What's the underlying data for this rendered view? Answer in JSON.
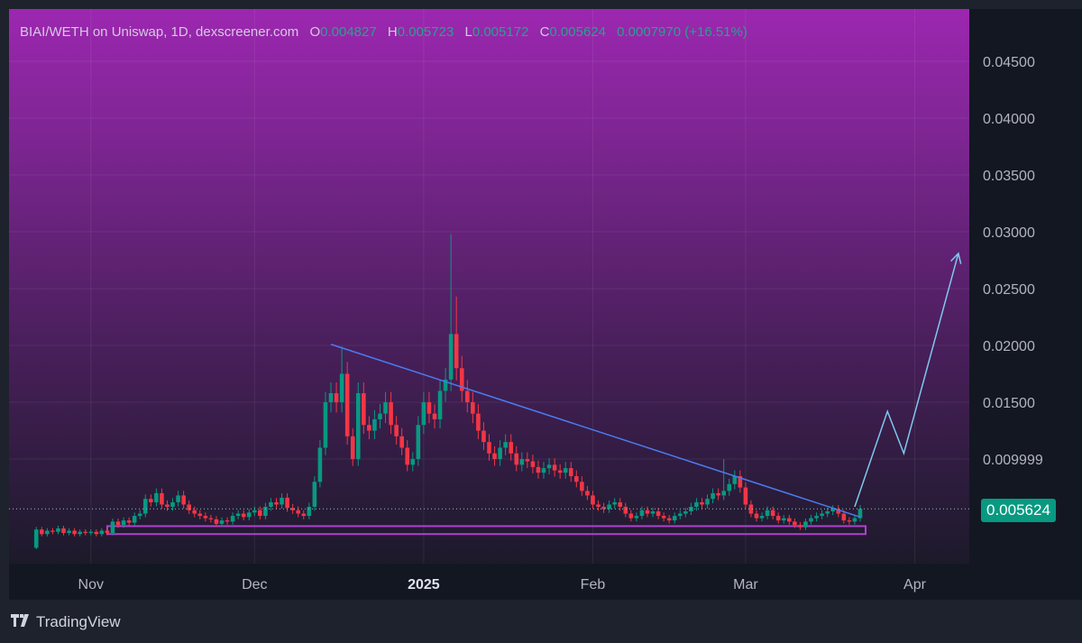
{
  "header": {
    "title": "BIAI/WETH on Uniswap, 1D, dexscreener.com",
    "o_label": "O",
    "open": "0.004827",
    "h_label": "H",
    "high": "0.005723",
    "l_label": "L",
    "low": "0.005172",
    "c_label": "C",
    "close": "0.005624",
    "change": "0.0007970 (+16.51%)"
  },
  "last_price_label": "0.005624",
  "footer": {
    "brand": "TradingView",
    "logo": "TV"
  },
  "colors": {
    "up": "#089981",
    "down": "#f23645",
    "trendline": "#4a7cf0",
    "support": "#b040d0",
    "arrow": "#7ec8f0"
  },
  "chart_data": {
    "type": "candlestick",
    "title": "BIAI/WETH on Uniswap, 1D",
    "start_date": "2024-10-22",
    "y_ticks": [
      "0.04500",
      "0.04000",
      "0.03500",
      "0.03000",
      "0.02500",
      "0.02000",
      "0.01500",
      "0.009999"
    ],
    "y_tick_values": [
      0.045,
      0.04,
      0.035,
      0.03,
      0.025,
      0.02,
      0.015,
      0.01
    ],
    "ylim": [
      0.0008,
      0.0496
    ],
    "x_ticks": [
      {
        "label": "Nov",
        "index": 10,
        "bold": false
      },
      {
        "label": "Dec",
        "index": 40,
        "bold": false
      },
      {
        "label": "2025",
        "index": 71,
        "bold": true
      },
      {
        "label": "Feb",
        "index": 102,
        "bold": false
      },
      {
        "label": "Mar",
        "index": 130,
        "bold": false
      },
      {
        "label": "Apr",
        "index": 161,
        "bold": false
      }
    ],
    "xlim": [
      -5,
      171
    ],
    "first_open": 0.0022,
    "closes": [
      0.0038,
      0.0034,
      0.0037,
      0.0036,
      0.0039,
      0.0035,
      0.0037,
      0.0034,
      0.0036,
      0.0035,
      0.0036,
      0.0034,
      0.0037,
      0.0035,
      0.0045,
      0.0042,
      0.0046,
      0.0044,
      0.005,
      0.0052,
      0.0065,
      0.0062,
      0.007,
      0.006,
      0.0058,
      0.0062,
      0.0068,
      0.006,
      0.0055,
      0.0052,
      0.005,
      0.0048,
      0.0047,
      0.0043,
      0.0046,
      0.0045,
      0.005,
      0.0052,
      0.0049,
      0.0053,
      0.0055,
      0.005,
      0.0058,
      0.0062,
      0.006,
      0.0066,
      0.0057,
      0.0055,
      0.0052,
      0.005,
      0.0058,
      0.008,
      0.011,
      0.015,
      0.0158,
      0.015,
      0.0175,
      0.012,
      0.01,
      0.0158,
      0.013,
      0.0125,
      0.0135,
      0.014,
      0.015,
      0.013,
      0.012,
      0.011,
      0.0095,
      0.01,
      0.013,
      0.015,
      0.014,
      0.0135,
      0.016,
      0.017,
      0.021,
      0.018,
      0.016,
      0.015,
      0.014,
      0.0125,
      0.0115,
      0.0105,
      0.01,
      0.011,
      0.0115,
      0.0105,
      0.0095,
      0.01,
      0.0098,
      0.0093,
      0.0088,
      0.0092,
      0.0095,
      0.009,
      0.0088,
      0.0092,
      0.0085,
      0.008,
      0.0072,
      0.0068,
      0.006,
      0.0058,
      0.0056,
      0.006,
      0.0062,
      0.0058,
      0.0052,
      0.0048,
      0.005,
      0.0055,
      0.0052,
      0.0054,
      0.005,
      0.0048,
      0.0046,
      0.005,
      0.0052,
      0.0054,
      0.0058,
      0.0062,
      0.006,
      0.0065,
      0.007,
      0.0068,
      0.0072,
      0.0078,
      0.0085,
      0.0075,
      0.006,
      0.0052,
      0.0048,
      0.005,
      0.0055,
      0.005,
      0.0046,
      0.0048,
      0.0045,
      0.0042,
      0.004,
      0.0045,
      0.0048,
      0.005,
      0.0052,
      0.0054,
      0.0056,
      0.0052,
      0.0046,
      0.0045,
      0.0048,
      0.005624
    ],
    "spikes": [
      {
        "index": 76,
        "high": 0.0298
      },
      {
        "index": 77,
        "high": 0.0243
      },
      {
        "index": 56,
        "high": 0.0199
      },
      {
        "index": 126,
        "high": 0.01
      }
    ],
    "last_price": 0.005624,
    "annotations": {
      "trendline": [
        [
          54,
          0.0201
        ],
        [
          151,
          0.0049
        ]
      ],
      "support_zone": {
        "from": 13,
        "to": 152,
        "low": 0.0034,
        "high": 0.0041
      },
      "projection_arrow": [
        [
          150,
          0.0058
        ],
        [
          156,
          0.0142
        ],
        [
          159,
          0.0105
        ],
        [
          169,
          0.0281
        ]
      ]
    }
  }
}
